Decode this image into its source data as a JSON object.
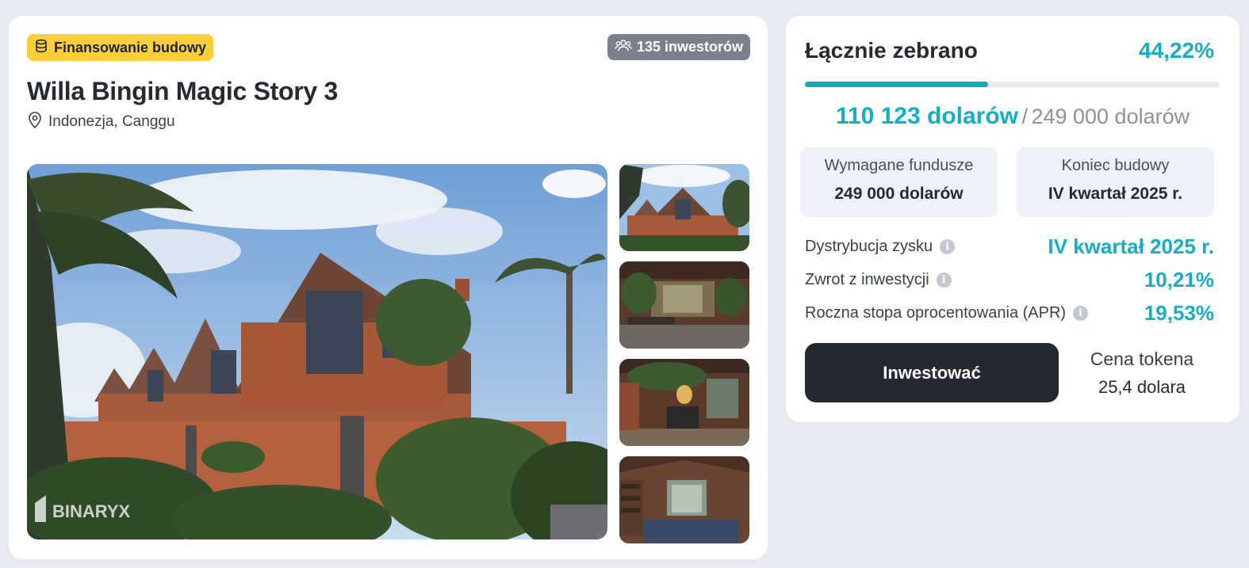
{
  "project": {
    "category_badge": "Finansowanie budowy",
    "investors_badge": "135 inwestorów",
    "title": "Willa Bingin Magic Story 3",
    "location": "Indonezja, Canggu",
    "watermark": "BINARYX"
  },
  "funding": {
    "collected_label": "Łącznie zebrano",
    "collected_percent": "44,22%",
    "progress_fraction": 0.4422,
    "raised": "110 123 dolarów",
    "separator": "/",
    "goal": "249 000 dolarów",
    "required_label": "Wymagane fundusze",
    "required_value": "249 000 dolarów",
    "end_label": "Koniec budowy",
    "end_value": "IV kwartał 2025 r.",
    "stats": [
      {
        "label": "Dystrybucja zysku",
        "value": "IV kwartał 2025 r."
      },
      {
        "label": "Zwrot z inwestycji",
        "value": "10,21%"
      },
      {
        "label": "Roczna stopa oprocentowania (APR)",
        "value": "19,53%"
      }
    ],
    "invest_button": "Inwestować",
    "token_label": "Cena tokena",
    "token_price": "25,4 dolara"
  },
  "colors": {
    "accent": "#14aec5",
    "badge_yellow": "#fbcf3a",
    "button_dark": "#232833"
  }
}
